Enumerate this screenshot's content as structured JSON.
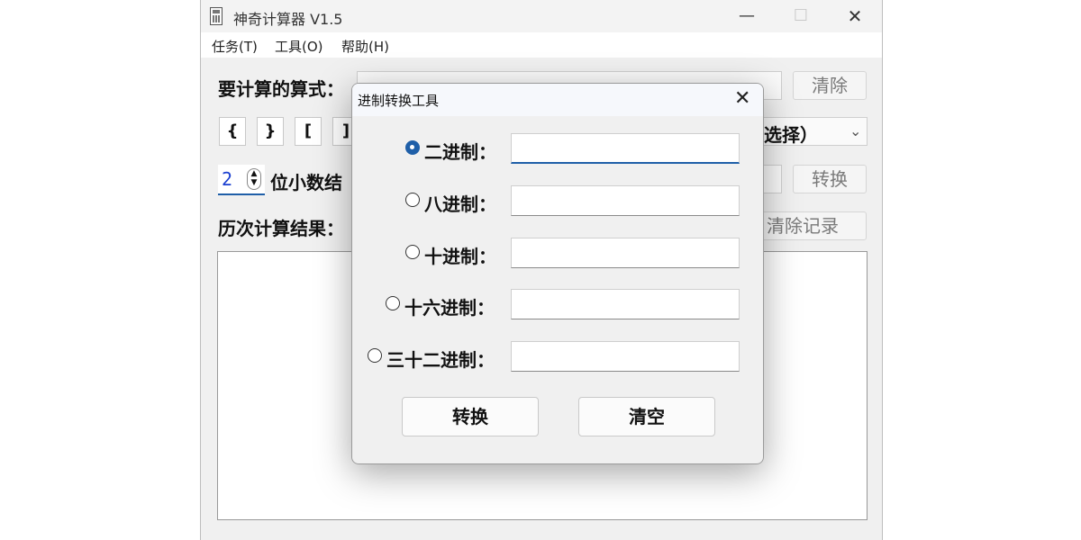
{
  "window": {
    "title": "神奇计算器 V1.5",
    "min_glyph": "—",
    "max_glyph": "☐",
    "close_glyph": "✕"
  },
  "menu": [
    {
      "label": "任务(T)"
    },
    {
      "label": "工具(O)"
    },
    {
      "label": "帮助(H)"
    }
  ],
  "main": {
    "expression_label": "要计算的算式：",
    "clear_button": "清除",
    "brackets": [
      "{",
      "}",
      "[",
      "]"
    ],
    "select_partial_text": "选择）",
    "decimal_value": "2",
    "decimal_label": "位小数结",
    "convert_button": "转换",
    "history_label": "历次计算结果：",
    "clear_history_button": "清除记录"
  },
  "dialog": {
    "title": "进制转换工具",
    "close_glyph": "✕",
    "selected_base": "二进制",
    "bases": [
      {
        "label": "二进制：",
        "value": ""
      },
      {
        "label": "八进制：",
        "value": ""
      },
      {
        "label": "十进制：",
        "value": ""
      },
      {
        "label": "十六进制：",
        "value": ""
      },
      {
        "label": "三十二进制：",
        "value": ""
      }
    ],
    "convert_button": "转换",
    "clear_button": "清空"
  },
  "colors": {
    "accent": "#1f5fa8",
    "spin_value": "#1a3fd0"
  }
}
